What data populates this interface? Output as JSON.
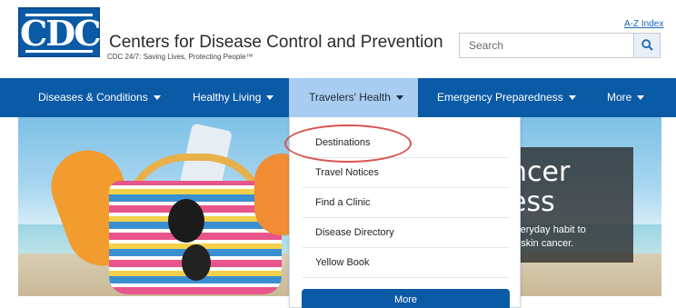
{
  "header": {
    "logo_text": "CDC",
    "title": "Centers for Disease Control and Prevention",
    "tagline": "CDC 24/7: Saving Lives, Protecting People™",
    "az_index": "A-Z Index",
    "search": {
      "placeholder": "Search",
      "icon": "search-icon"
    }
  },
  "colors": {
    "nav_background": "#0b5aa6",
    "nav_active": "#a9cdf0",
    "highlight_ring": "#d9534f"
  },
  "nav": {
    "items": [
      {
        "label": "Diseases & Conditions",
        "active": false
      },
      {
        "label": "Healthy Living",
        "active": false
      },
      {
        "label": "Travelers' Health",
        "active": true
      },
      {
        "label": "Emergency Preparedness",
        "active": false
      },
      {
        "label": "More",
        "active": false
      }
    ]
  },
  "dropdown": {
    "items": [
      {
        "label": "Destinations",
        "highlighted": true
      },
      {
        "label": "Travel Notices"
      },
      {
        "label": "Find a Clinic"
      },
      {
        "label": "Disease Directory"
      },
      {
        "label": "Yellow Book"
      }
    ],
    "more_label": "More"
  },
  "hero": {
    "headline_line1": "ncer",
    "headline_line2": "ess",
    "body_line1": "everyday habit to",
    "body_line2": "of skin cancer."
  }
}
